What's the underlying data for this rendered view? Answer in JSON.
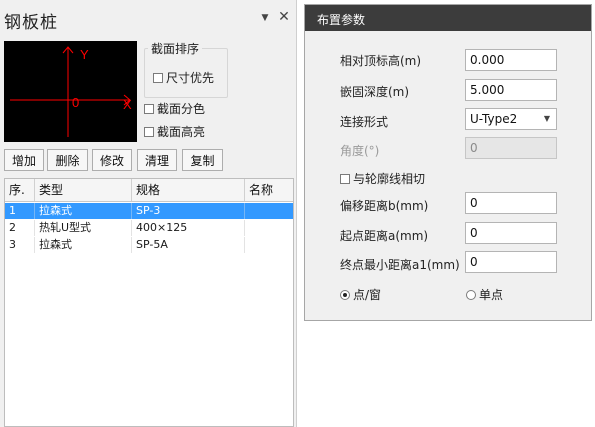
{
  "left_panel": {
    "title": "钢板桩",
    "preview": {
      "axis_y": "Y",
      "axis_x": "X",
      "origin": "0",
      "axis_color": "#ff0000"
    },
    "section_order": {
      "legend": "截面排序",
      "size_priority": "尺寸优先"
    },
    "checkboxes": {
      "section_color": "截面分色",
      "section_highlight": "截面高亮"
    },
    "buttons": {
      "add": "增加",
      "delete": "删除",
      "modify": "修改",
      "clear": "清理",
      "copy": "复制"
    },
    "table": {
      "columns": [
        "序.",
        "类型",
        "规格",
        "名称"
      ],
      "rows": [
        {
          "no": "1",
          "type": "拉森式",
          "spec": "SP-3",
          "name": "",
          "selected": true
        },
        {
          "no": "2",
          "type": "热轧U型式",
          "spec": "400×125",
          "name": "",
          "selected": false
        },
        {
          "no": "3",
          "type": "拉森式",
          "spec": "SP-5A",
          "name": "",
          "selected": false
        }
      ]
    }
  },
  "right_panel": {
    "title": "布置参数",
    "fields": {
      "top_elevation": {
        "label": "相对顶标高(m)",
        "value": "0.000"
      },
      "embed_depth": {
        "label": "嵌固深度(m)",
        "value": "5.000"
      },
      "connection": {
        "label": "连接形式",
        "value": "U-Type2"
      },
      "angle": {
        "label": "角度(°)",
        "value": "0"
      },
      "tangent": {
        "label": "与轮廓线相切"
      },
      "offset": {
        "label": "偏移距离b(mm)",
        "value": "0"
      },
      "start_dist": {
        "label": "起点距离a(mm)",
        "value": "0"
      },
      "end_min_dist": {
        "label": "终点最小距离a1(mm)",
        "value": "0"
      }
    },
    "radios": {
      "point_window": "点/窗",
      "single_point": "单点"
    }
  },
  "colors": {
    "selection": "#3399ff",
    "header_dark": "#3c3c3c"
  }
}
